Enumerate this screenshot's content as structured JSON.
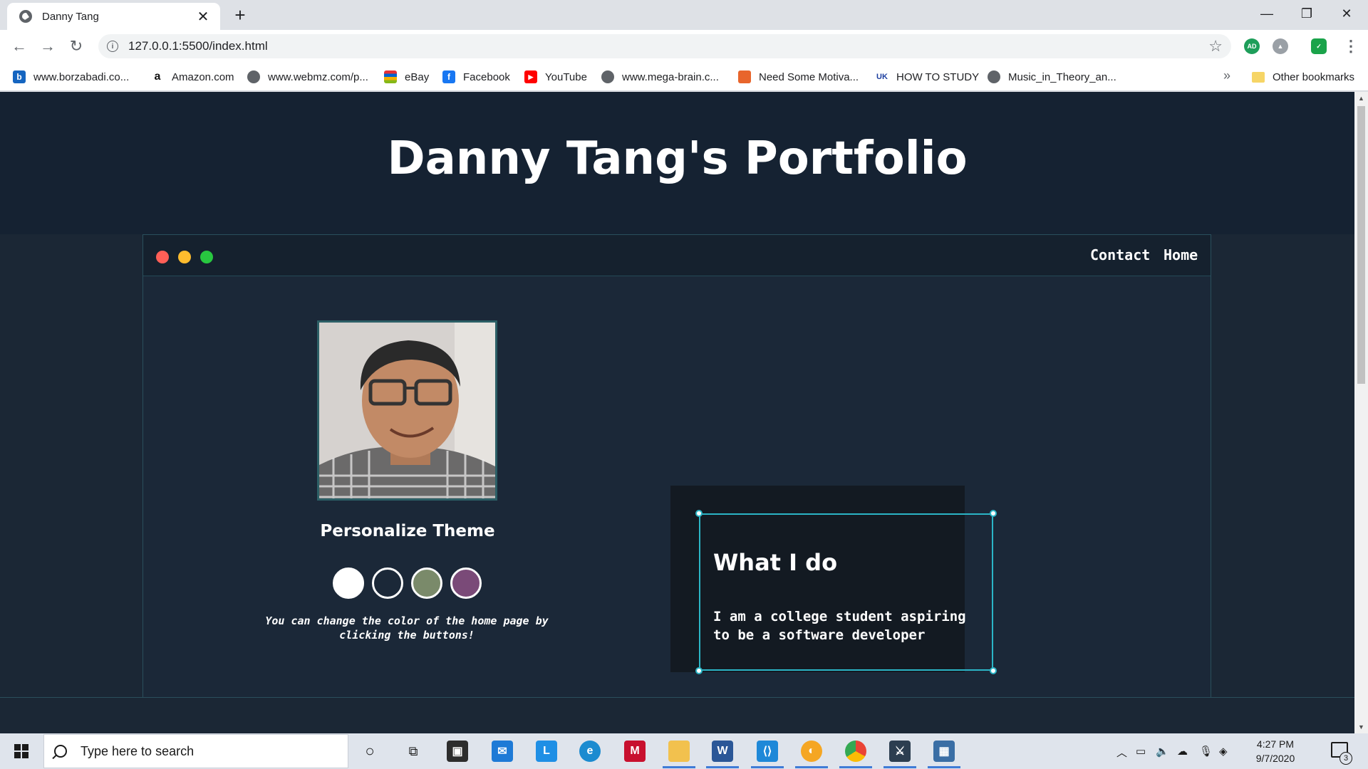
{
  "browser": {
    "tab_title": "Danny Tang",
    "url": "127.0.0.1:5500/index.html",
    "bookmarks": [
      {
        "label": "www.borzabadi.co..."
      },
      {
        "label": "Amazon.com"
      },
      {
        "label": "www.webmz.com/p..."
      },
      {
        "label": "eBay"
      },
      {
        "label": "Facebook"
      },
      {
        "label": "YouTube"
      },
      {
        "label": "www.mega-brain.c..."
      },
      {
        "label": "Need Some Motiva..."
      },
      {
        "label": "HOW TO STUDY"
      },
      {
        "label": "Music_in_Theory_an..."
      }
    ],
    "overflow_label": "»",
    "other_bookmarks": "Other bookmarks"
  },
  "page": {
    "title": "Danny Tang's Portfolio",
    "nav": {
      "contact": "Contact",
      "home": "Home"
    },
    "theme": {
      "heading": "Personalize Theme",
      "swatch_colors": [
        "#ffffff",
        "#1b2838",
        "#7a8a6a",
        "#7a4a78"
      ],
      "note": "You can change the color of the home page by clicking the buttons!"
    },
    "card": {
      "title": "What I do",
      "text": "I am a college student aspiring to be a software developer"
    },
    "window_dot_colors": [
      "#ff5f57",
      "#febc2e",
      "#28c840"
    ]
  },
  "taskbar": {
    "search_placeholder": "Type here to search",
    "time": "4:27 PM",
    "date": "9/7/2020",
    "notification_count": "3"
  }
}
